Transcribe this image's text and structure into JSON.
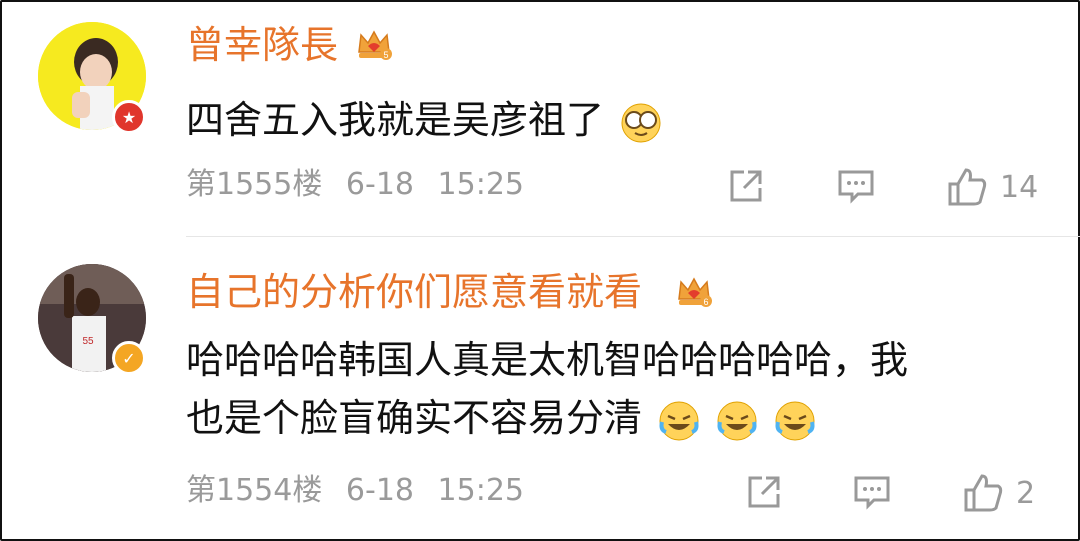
{
  "comments": [
    {
      "username": "曾幸隊長",
      "vip_level": "5",
      "text_lines": [
        "四舍五入我就是吴彦祖了"
      ],
      "floor": "第1555楼",
      "date": "6-18",
      "time": "15:25",
      "likes": "14",
      "badge_icon": "red-star-badge-icon",
      "emoji": [
        "glasses-face-emoji-icon"
      ]
    },
    {
      "username": "自己的分析你们愿意看就看",
      "vip_level": "6",
      "text_lines": [
        "哈哈哈哈韩国人真是太机智哈哈哈哈哈，我",
        "也是个脸盲确实不容易分清"
      ],
      "floor": "第1554楼",
      "date": "6-18",
      "time": "15:25",
      "likes": "2",
      "badge_icon": "gold-verified-badge-icon",
      "emoji": [
        "laugh-cry-emoji-icon",
        "laugh-cry-emoji-icon",
        "laugh-cry-emoji-icon"
      ]
    }
  ],
  "colors": {
    "username": "#e7742b",
    "meta": "#9a9a9a",
    "text": "#111111"
  }
}
